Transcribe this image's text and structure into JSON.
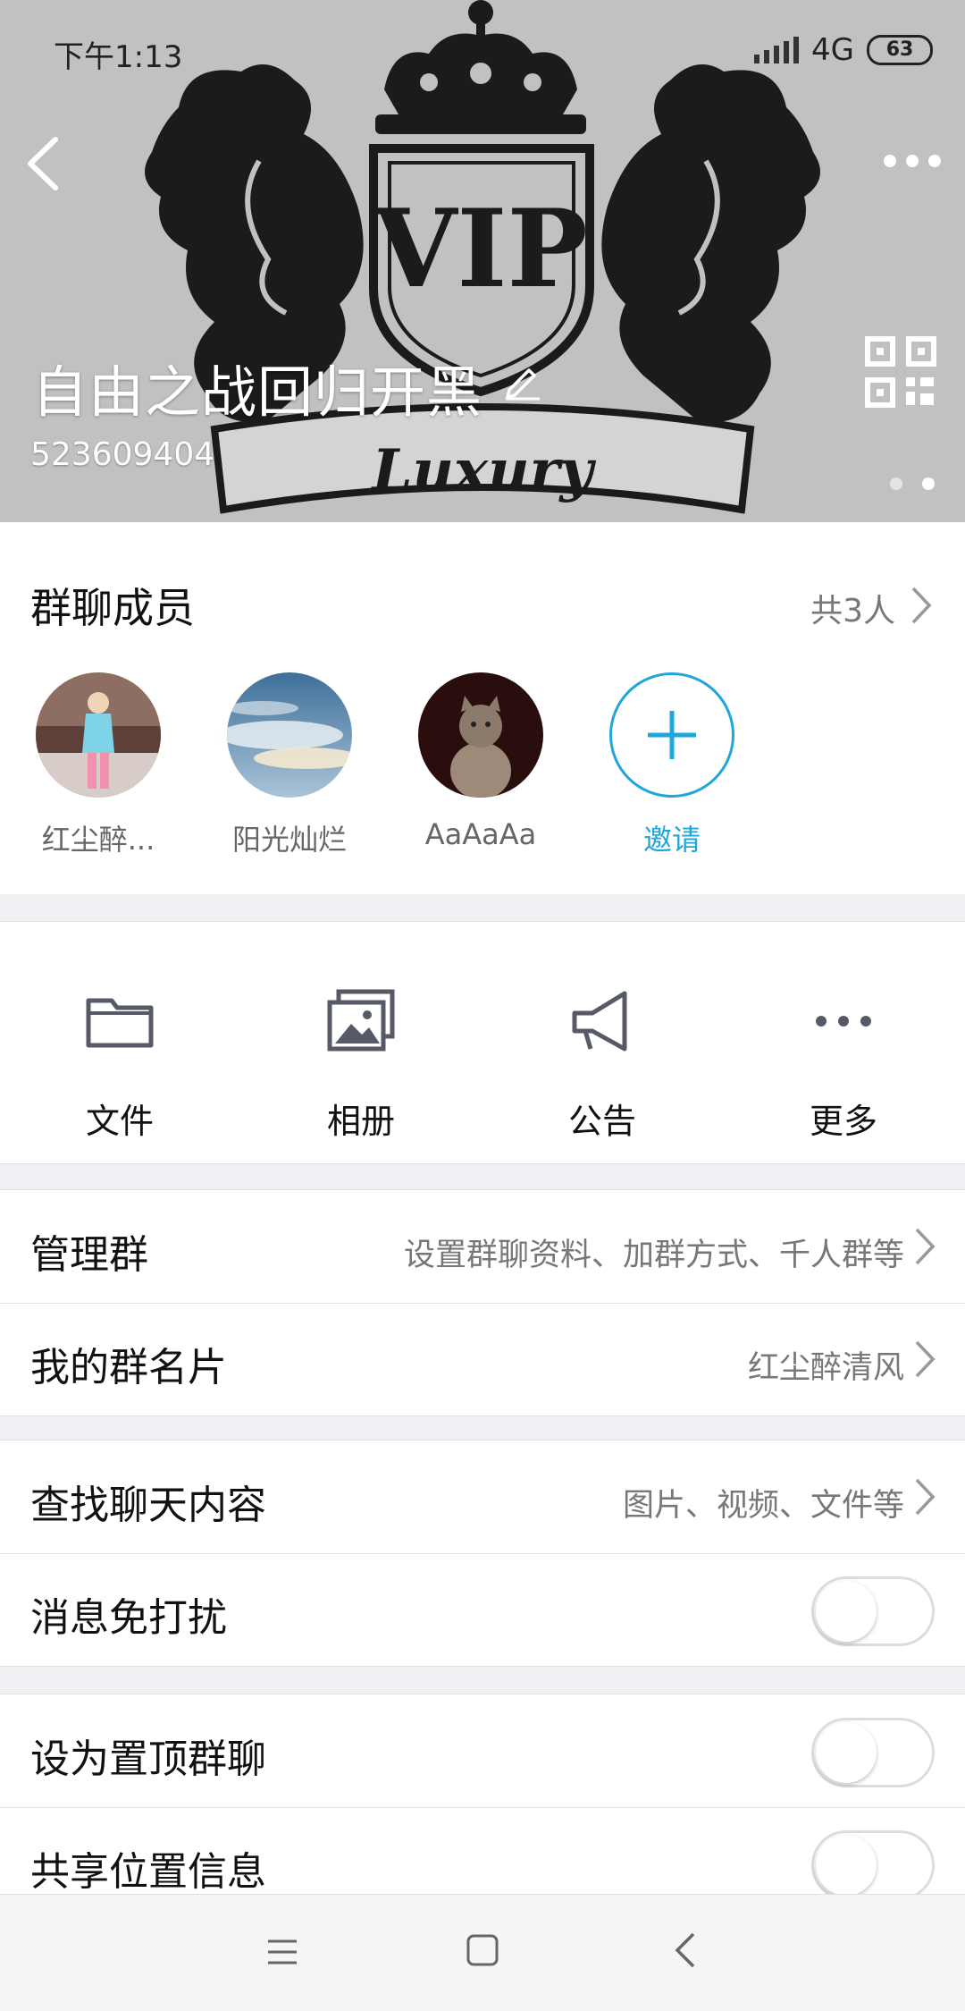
{
  "status_bar": {
    "time": "下午1:13",
    "network": "4G",
    "battery": "63"
  },
  "header": {
    "group_name": "自由之战回归开黑",
    "group_id": "523609404",
    "banner_text": "VIP",
    "banner_ribbon": "Luxury"
  },
  "members": {
    "title": "群聊成员",
    "count": "共3人",
    "list": [
      {
        "name": "红尘醉..."
      },
      {
        "name": "阳光灿烂"
      },
      {
        "name": "AaAaAa"
      }
    ],
    "invite_label": "邀请"
  },
  "actions": [
    {
      "label": "文件",
      "icon": "folder-icon"
    },
    {
      "label": "相册",
      "icon": "photo-album-icon"
    },
    {
      "label": "公告",
      "icon": "megaphone-icon"
    },
    {
      "label": "更多",
      "icon": "more-dots-icon"
    }
  ],
  "rows": {
    "manage": {
      "title": "管理群",
      "value": "设置群聊资料、加群方式、千人群等"
    },
    "card": {
      "title": "我的群名片",
      "value": "红尘醉清风"
    },
    "search": {
      "title": "查找聊天内容",
      "value": "图片、视频、文件等"
    },
    "mute": {
      "title": "消息免打扰",
      "on": false
    },
    "pin": {
      "title": "设为置顶群聊",
      "on": false
    },
    "location": {
      "title": "共享位置信息",
      "on": false
    }
  },
  "colors": {
    "accent": "#1fa6da",
    "header_bg": "#c1c1c1"
  }
}
